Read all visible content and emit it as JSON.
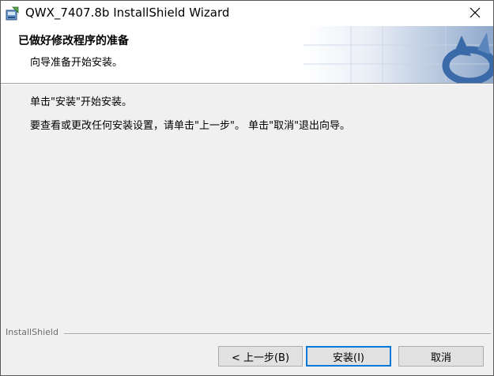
{
  "window": {
    "title": "QWX_7407.8b InstallShield Wizard"
  },
  "header": {
    "title": "已做好修改程序的准备",
    "subtitle": "向导准备开始安装。"
  },
  "body": {
    "line1": "单击\"安装\"开始安装。",
    "line2": "要查看或更改任何安装设置，请单击\"上一步\"。 单击\"取消\"退出向导。"
  },
  "footer": {
    "brand": "InstallShield"
  },
  "buttons": {
    "back": "< 上一步(B)",
    "install": "安装(I)",
    "cancel": "取消"
  },
  "colors": {
    "banner_blue": "#3a6aa8",
    "focus_border": "#0078d7",
    "button_face": "#e1e1e1"
  }
}
